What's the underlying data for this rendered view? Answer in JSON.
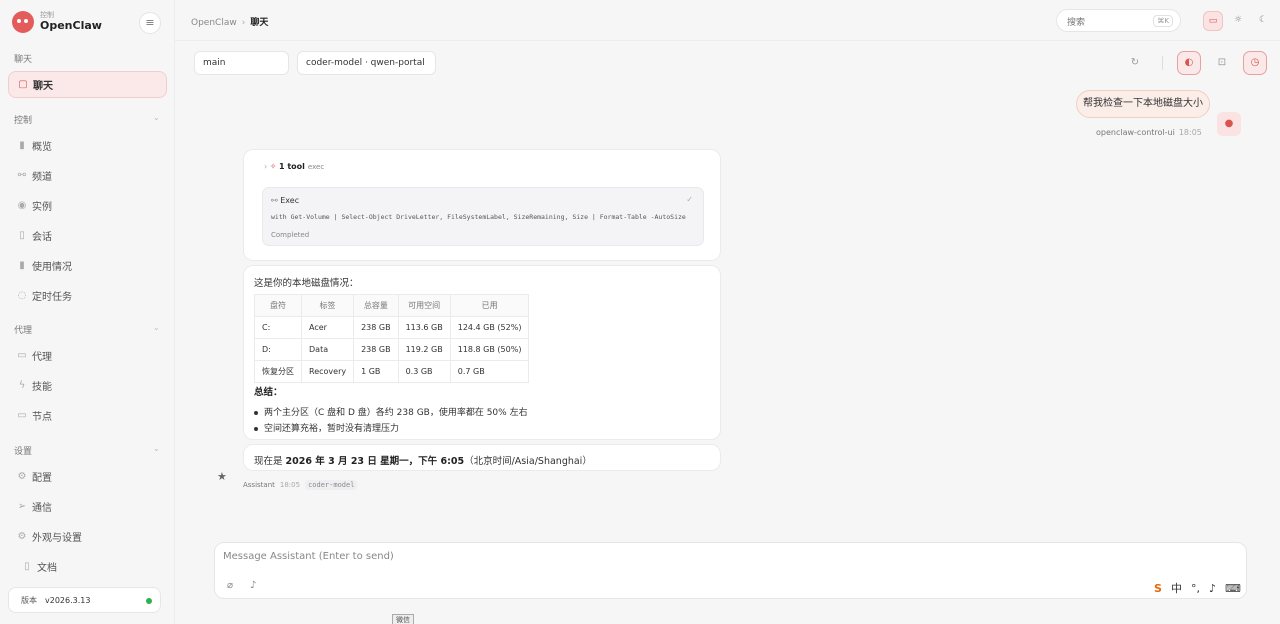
{
  "brand": {
    "small": "控制",
    "name": "OpenClaw"
  },
  "sidebar": {
    "sections": [
      {
        "label": "聊天",
        "items": [
          {
            "label": "聊天",
            "icon": "message-icon",
            "active": true
          }
        ]
      },
      {
        "label": "控制",
        "items": [
          {
            "label": "概览",
            "icon": "bar-chart-icon"
          },
          {
            "label": "频道",
            "icon": "link-icon"
          },
          {
            "label": "实例",
            "icon": "radio-icon"
          },
          {
            "label": "会话",
            "icon": "document-icon"
          },
          {
            "label": "使用情况",
            "icon": "bar-chart-icon"
          },
          {
            "label": "定时任务",
            "icon": "loader-icon"
          }
        ]
      },
      {
        "label": "代理",
        "items": [
          {
            "label": "代理",
            "icon": "folder-icon"
          },
          {
            "label": "技能",
            "icon": "lightning-icon"
          },
          {
            "label": "节点",
            "icon": "monitor-icon"
          }
        ]
      },
      {
        "label": "设置",
        "items": [
          {
            "label": "配置",
            "icon": "gear-icon"
          },
          {
            "label": "通信",
            "icon": "send-icon"
          },
          {
            "label": "外观与设置",
            "icon": "gear-icon"
          }
        ]
      }
    ],
    "docs": "文档",
    "version_label": "版本",
    "version": "v2026.3.13"
  },
  "topbar": {
    "crumb_root": "OpenClaw",
    "crumb_current": "聊天",
    "search_placeholder": "搜索",
    "search_shortcut": "⌘K"
  },
  "session": {
    "agent": "main",
    "model": "coder-model · qwen-portal"
  },
  "user_message": {
    "text": "帮我检查一下本地磁盘大小",
    "sender": "openclaw-control-ui",
    "time": "18:05"
  },
  "tool_card": {
    "count": "1 tool",
    "name": "exec",
    "title": "Exec",
    "command": "with Get-Volume | Select-Object DriveLetter, FileSystemLabel, SizeRemaining, Size | Format-Table -AutoSize",
    "status": "Completed"
  },
  "reply": {
    "intro": "这是你的本地磁盘情况：",
    "headers": [
      "盘符",
      "标签",
      "总容量",
      "可用空间",
      "已用"
    ],
    "rows": [
      [
        "C:",
        "Acer",
        "238 GB",
        "113.6 GB",
        "124.4 GB (52%)"
      ],
      [
        "D:",
        "Data",
        "238 GB",
        "119.2 GB",
        "118.8 GB (50%)"
      ],
      [
        "恢复分区",
        "Recovery",
        "1 GB",
        "0.3 GB",
        "0.7 GB"
      ]
    ],
    "summary_title": "总结：",
    "bullets": [
      "两个主分区（C 盘和 D 盘）各约 238 GB，使用率都在 50% 左右",
      "空间还算充裕，暂时没有清理压力"
    ]
  },
  "time_card": {
    "prefix": "现在是",
    "bold": "2026 年 3 月 23 日 星期一，下午 6:05",
    "suffix": "（北京时间/Asia/Shanghai）"
  },
  "assistant_meta": {
    "name": "Assistant",
    "time": "18:05",
    "model": "coder-model"
  },
  "composer": {
    "placeholder": "Message Assistant (Enter to send)"
  },
  "ime": {
    "logo": "S",
    "mode": "中"
  },
  "taskbar": {
    "label": "微信"
  }
}
